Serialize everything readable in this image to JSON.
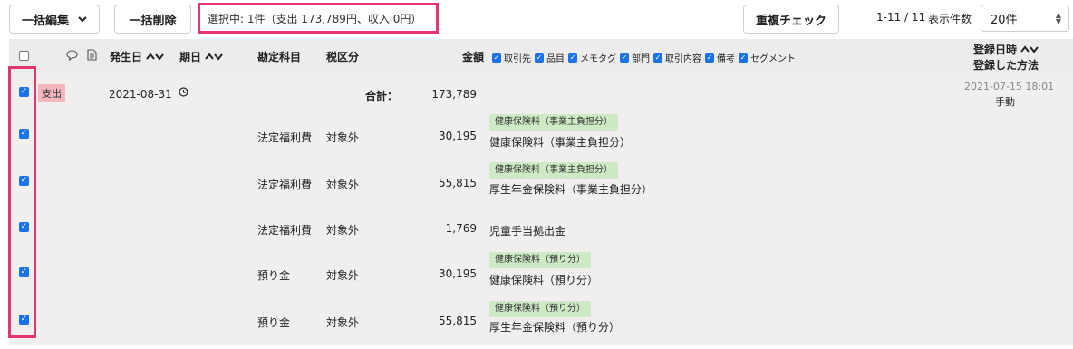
{
  "toolbar": {
    "bulk_edit_label": "一括編集",
    "bulk_delete_label": "一括削除",
    "selection_status": "選択中: 1件（支出 173,789円、収入 0円）",
    "duplicate_check_label": "重複チェック",
    "pagination": "1-11 / 11",
    "per_page_label": "表示件数",
    "per_page_value": "20件"
  },
  "header": {
    "issue_date": "発生日",
    "due_date": "期日",
    "account": "勘定科目",
    "tax": "税区分",
    "amount": "金額",
    "registered_at": "登録日時",
    "registered_method": "登録した方法",
    "filters": [
      {
        "label": "取引先",
        "checked": true
      },
      {
        "label": "品目",
        "checked": true
      },
      {
        "label": "メモタグ",
        "checked": true
      },
      {
        "label": "部門",
        "checked": true
      },
      {
        "label": "取引内容",
        "checked": true
      },
      {
        "label": "備考",
        "checked": true
      },
      {
        "label": "セグメント",
        "checked": true
      }
    ]
  },
  "transaction": {
    "type_badge": "支出",
    "issue_date": "2021-08-31",
    "total_label": "合計：",
    "total_amount": "173,789",
    "registered_at": "2021-07-15 18:01",
    "registered_method": "手動",
    "checked": true
  },
  "lines": [
    {
      "account": "法定福利費",
      "tax": "対象外",
      "amount": "30,195",
      "tag": "健康保険料（事業主負担分）",
      "description": "健康保険料（事業主負担分）",
      "checked": true
    },
    {
      "account": "法定福利費",
      "tax": "対象外",
      "amount": "55,815",
      "tag": "健康保険料（事業主負担分）",
      "description": "厚生年金保険料（事業主負担分）",
      "checked": true
    },
    {
      "account": "法定福利費",
      "tax": "対象外",
      "amount": "1,769",
      "tag": "",
      "description": "児童手当拠出金",
      "checked": true
    },
    {
      "account": "預り金",
      "tax": "対象外",
      "amount": "30,195",
      "tag": "健康保険料（預り分）",
      "description": "健康保険料（預り分）",
      "checked": true
    },
    {
      "account": "預り金",
      "tax": "対象外",
      "amount": "55,815",
      "tag": "健康保険料（預り分）",
      "description": "厚生年金保険料（預り分）",
      "checked": true
    }
  ]
}
